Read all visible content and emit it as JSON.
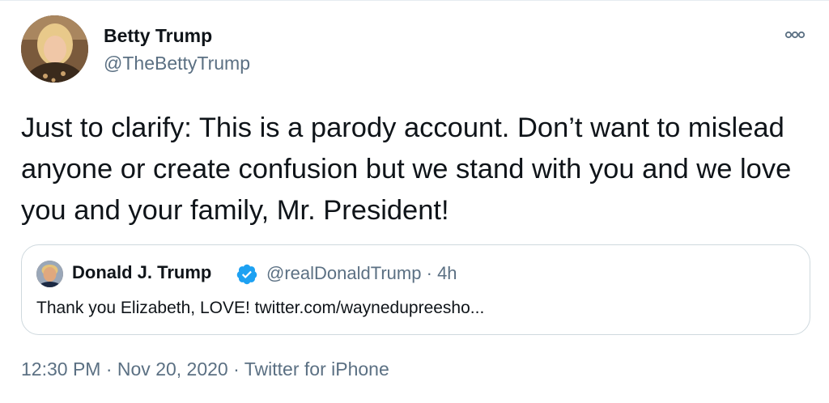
{
  "author": {
    "name": "Betty Trump",
    "handle": "@TheBettyTrump",
    "avatar_icon": "profile-photo-avatar"
  },
  "menu_icon": "more-options-icon",
  "tweet_text": "Just to clarify: This is a parody account. Don’t want to mislead anyone or create confusion but we stand with you and we love you and your family, Mr. President!",
  "quoted_tweet": {
    "name": "Donald J. Trump",
    "verified_icon": "verified-badge-icon",
    "handle": "@realDonaldTrump",
    "separator": "·",
    "age": "4h",
    "text": "Thank you Elizabeth, LOVE! twitter.com/waynedupreesho..."
  },
  "footer": {
    "time": "12:30 PM",
    "separator": "·",
    "date": "Nov 20, 2020",
    "source": "Twitter for iPhone"
  },
  "colors": {
    "text_primary": "#0f1419",
    "text_secondary": "#5b7083",
    "verified_blue": "#1da1f2",
    "border": "#cfd9de"
  }
}
